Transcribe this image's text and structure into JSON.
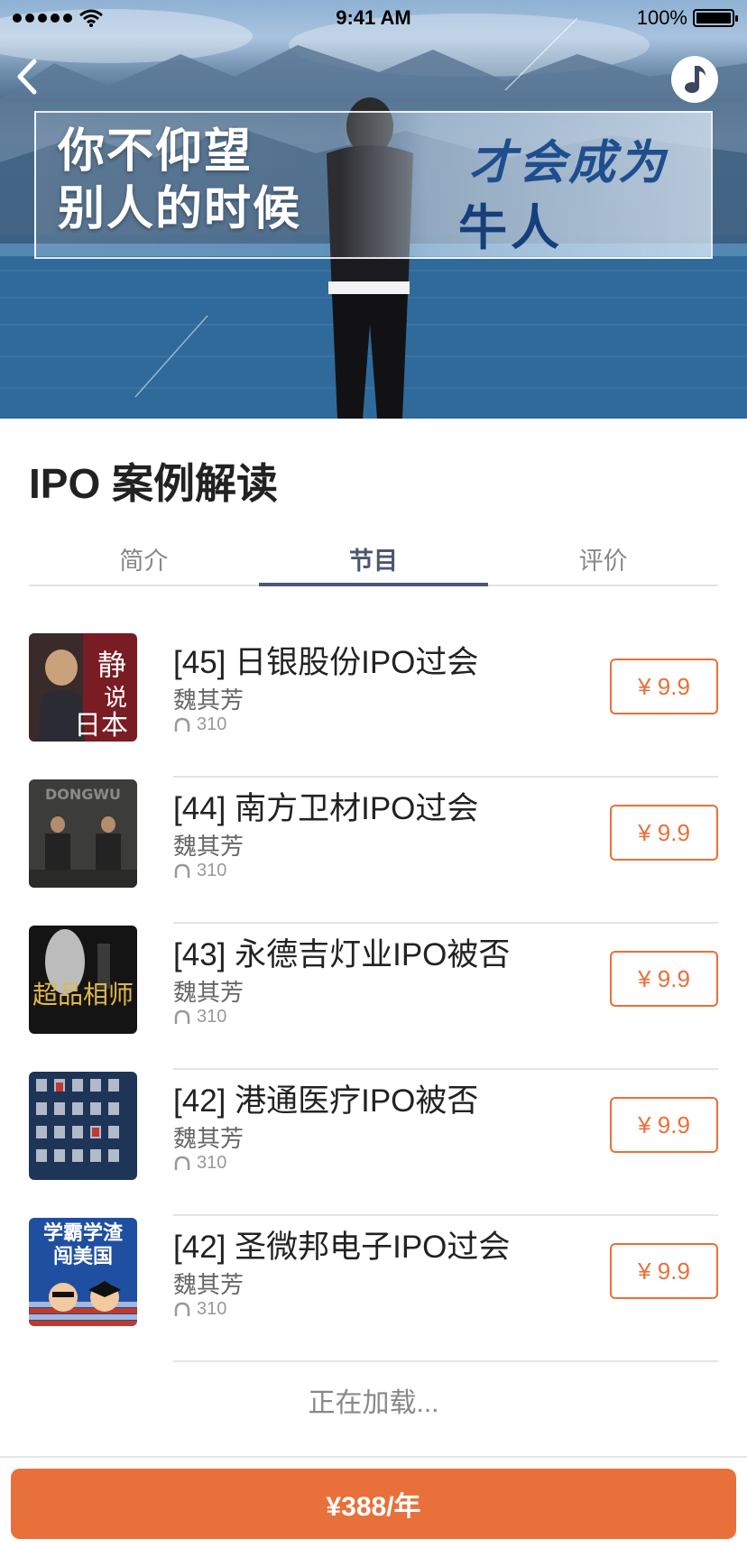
{
  "status_bar": {
    "time": "9:41 AM",
    "battery": "100%"
  },
  "hero": {
    "left_text_line1": "你不仰望",
    "left_text_line2": "别人的时候",
    "right_text_line1": "才会成为",
    "right_text_line2": "牛人"
  },
  "page_title": "IPO 案例解读",
  "tabs": [
    {
      "label": "简介",
      "active": false
    },
    {
      "label": "节目",
      "active": true
    },
    {
      "label": "评价",
      "active": false
    }
  ],
  "episodes": [
    {
      "title": "[45] 日银股份IPO过会",
      "author": "魏其芳",
      "plays": "310",
      "price": "¥ 9.9",
      "cover_text": "静说日本"
    },
    {
      "title": "[44] 南方卫材IPO过会",
      "author": "魏其芳",
      "plays": "310",
      "price": "¥ 9.9",
      "cover_text": "DONGWU"
    },
    {
      "title": "[43] 永德吉灯业IPO被否",
      "author": "魏其芳",
      "plays": "310",
      "price": "¥ 9.9",
      "cover_text": "超品相师"
    },
    {
      "title": "[42] 港通医疗IPO被否",
      "author": "魏其芳",
      "plays": "310",
      "price": "¥ 9.9",
      "cover_text": ""
    },
    {
      "title": "[42] 圣微邦电子IPO过会",
      "author": "魏其芳",
      "plays": "310",
      "price": "¥ 9.9",
      "cover_text": "学霸学渣闯美国"
    }
  ],
  "loading_text": "正在加载...",
  "buy_button": "¥388/年",
  "colors": {
    "accent": "#e8703a",
    "tab_active": "#4d5775"
  },
  "icons": [
    "back-chevron-icon",
    "music-note-icon",
    "headphones-icon",
    "signal-dots-icon",
    "wifi-icon",
    "battery-icon"
  ]
}
